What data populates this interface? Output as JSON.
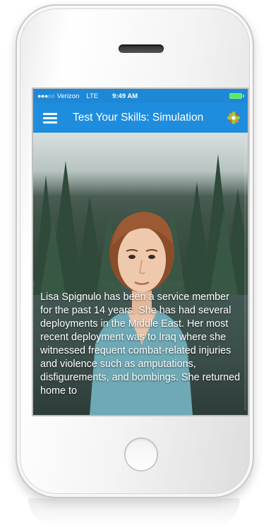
{
  "status_bar": {
    "signal": "●●●○○",
    "carrier": "Verizon",
    "network": "LTE",
    "time": "9:49 AM"
  },
  "nav_bar": {
    "title": "Test Your Skills: Simulation",
    "menu_icon": "hamburger-menu-icon",
    "settings_icon": "gear-icon"
  },
  "content": {
    "narrative": "Lisa Spignulo has been a service member for the past 14 years. She has had several deployments in the Middle East. Her most recent deployment was to Iraq where she witnessed frequent combat-related injuries and violence such as amputations, disfigurements, and bombings. She returned home to"
  },
  "colors": {
    "status_bar": "#1e88d6",
    "nav_bar": "#1f8ddd",
    "text": "#ffffff"
  }
}
